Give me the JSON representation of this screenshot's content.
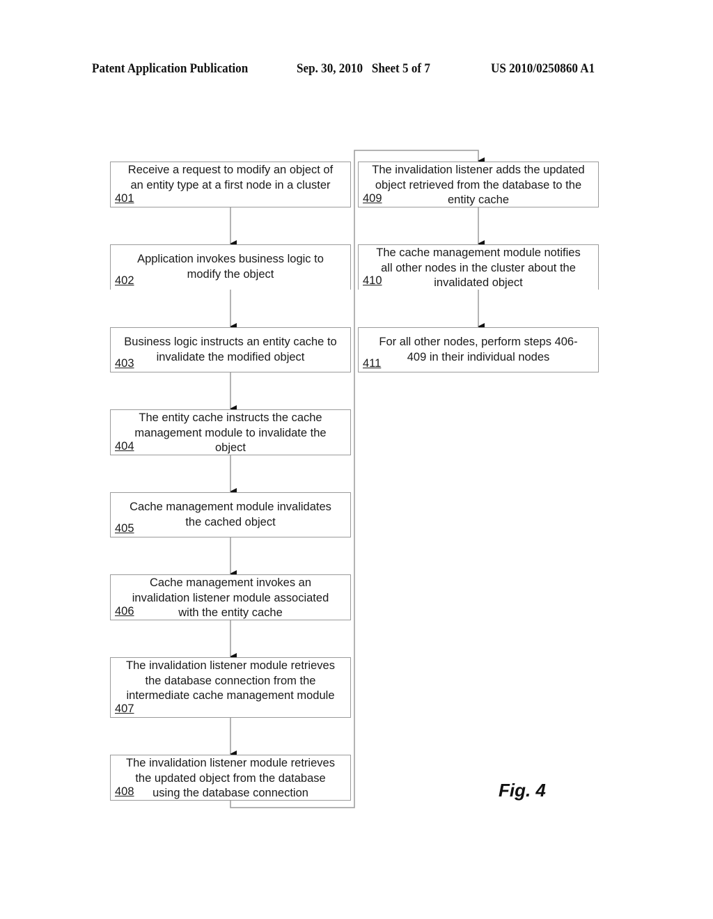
{
  "header": {
    "publication_type": "Patent Application Publication",
    "date_sheet": "Sep. 30, 2010   Sheet 5 of 7",
    "patent_number": "US 2010/0250860 A1"
  },
  "steps": [
    {
      "id": "401",
      "text": "Receive a request to modify an object of\nan entity type at a first node in a cluster"
    },
    {
      "id": "402",
      "text": "Application invokes business logic to\nmodify the object"
    },
    {
      "id": "403",
      "text": "Business logic instructs an entity cache to\ninvalidate the modified object"
    },
    {
      "id": "404",
      "text": "The entity cache instructs the cache\nmanagement module to invalidate the\nobject"
    },
    {
      "id": "405",
      "text": "Cache management module invalidates\nthe cached object"
    },
    {
      "id": "406",
      "text": "Cache management invokes an\ninvalidation listener module associated\nwith the entity cache"
    },
    {
      "id": "407",
      "text": "The invalidation listener module retrieves\nthe database connection from the\nintermediate cache management module"
    },
    {
      "id": "408",
      "text": "The invalidation listener module retrieves\nthe updated object from the database\nusing the database connection"
    },
    {
      "id": "409",
      "text": "The invalidation listener adds the updated\nobject retrieved from the database to the\nentity cache"
    },
    {
      "id": "410",
      "text": "The cache management module notifies\nall other nodes in the cluster about the\ninvalidated object"
    },
    {
      "id": "411",
      "text": "For all other nodes, perform steps 406-\n409 in their individual nodes"
    }
  ],
  "figure_label": "Fig. 4"
}
